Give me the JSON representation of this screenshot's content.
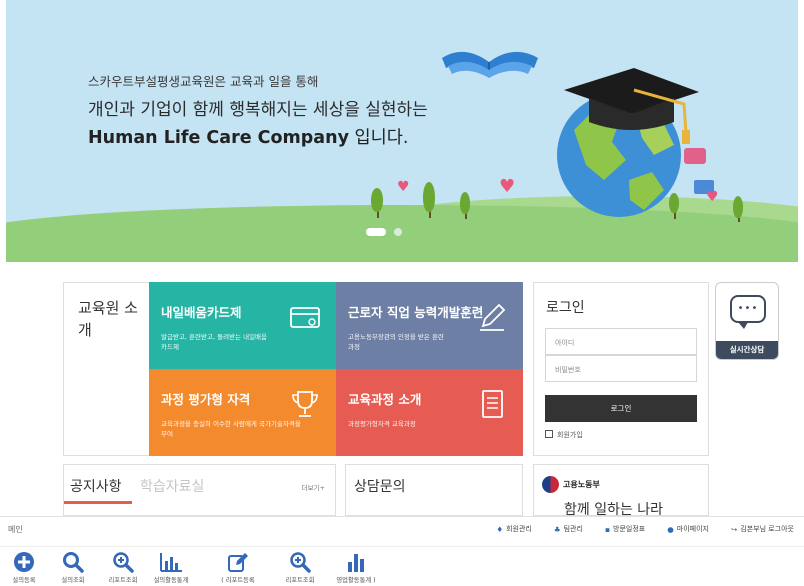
{
  "hero": {
    "line1": "스카우트부설평생교육원은 교육과 일을 통해",
    "line2": "개인과 기업이 함께 행복해지는 세상을 실현하는",
    "line3_bold": "Human Life Care Company",
    "line3_rest": " 입니다.",
    "slides": 2,
    "active_slide": 1
  },
  "intro": {
    "label": "교육원 소개"
  },
  "tiles": [
    {
      "title": "내일배움카드제",
      "desc": "발급받고, 훈련받고, 돌려받는 내일배움카드제",
      "icon": "card-icon",
      "color": "#26b5a4"
    },
    {
      "title": "근로자 직업 능력개발훈련",
      "desc": "고용노동부장관의 인정을 받은 훈련과정",
      "icon": "pen-icon",
      "color": "#6e7fa6"
    },
    {
      "title": "과정 평가형 자격",
      "desc": "교육과정을 충실히 이수한 사람에게 국가기술자격을 부여",
      "icon": "trophy-icon",
      "color": "#f48a2e"
    },
    {
      "title": "교육과정 소개",
      "desc": "과정평가형자격 교육과정",
      "icon": "document-icon",
      "color": "#e65c52"
    }
  ],
  "login": {
    "title": "로그인",
    "id_placeholder": "아이디",
    "pw_placeholder": "비밀번호",
    "button": "로그인",
    "join": "회원가입"
  },
  "chat": {
    "label": "실시간상담"
  },
  "notice": {
    "tab_active": "공지사항",
    "tab_inactive": "학습자료실",
    "more": "더보기+"
  },
  "consult": {
    "title": "상담문의"
  },
  "ministry": {
    "name": "고용노동부",
    "slogan": "함께 일하는 나라"
  },
  "appbar": {
    "breadcrumb": "메인",
    "links": [
      {
        "label": "회원관리",
        "icon": "user-manage-icon"
      },
      {
        "label": "팀관리",
        "icon": "team-icon"
      },
      {
        "label": "방문일정표",
        "icon": "calendar-icon"
      },
      {
        "label": "마이페이지",
        "icon": "person-icon"
      },
      {
        "label": "김본부님 로그아웃",
        "icon": "logout-icon"
      }
    ],
    "tools": [
      {
        "label": "설의등록",
        "icon": "plus-circle-icon"
      },
      {
        "label": "설의조회",
        "icon": "search-icon"
      },
      {
        "label": "리포트조회",
        "icon": "zoom-in-icon"
      },
      {
        "label": "설의활동통계",
        "icon": "bar-chart-icon"
      },
      {
        "label": "( 리포트등록",
        "icon": "edit-icon"
      },
      {
        "label": "리포트조회",
        "icon": "zoom-in-icon"
      },
      {
        "label": "영업활동통계 )",
        "icon": "stats-icon"
      }
    ]
  }
}
